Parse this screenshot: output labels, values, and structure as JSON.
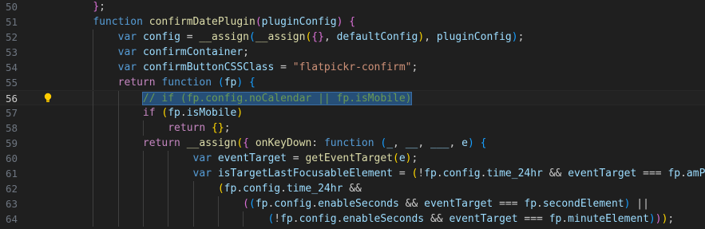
{
  "editor": {
    "language": "javascript",
    "active_line": 56,
    "lines": [
      {
        "num": "50",
        "tokens": [
          [
            "punc",
            "    "
          ],
          [
            "brk2",
            "}"
          ],
          [
            "punc",
            ";"
          ]
        ]
      },
      {
        "num": "51",
        "tokens": [
          [
            "punc",
            "    "
          ],
          [
            "kw-blue",
            "function"
          ],
          [
            "punc",
            " "
          ],
          [
            "fn",
            "confirmDatePlugin"
          ],
          [
            "brk2",
            "("
          ],
          [
            "var",
            "pluginConfig"
          ],
          [
            "brk2",
            ")"
          ],
          [
            "punc",
            " "
          ],
          [
            "brk2",
            "{"
          ]
        ]
      },
      {
        "num": "52",
        "tokens": [
          [
            "punc",
            "        "
          ],
          [
            "kw-blue",
            "var"
          ],
          [
            "punc",
            " "
          ],
          [
            "var",
            "config"
          ],
          [
            "punc",
            " = "
          ],
          [
            "fn",
            "__assign"
          ],
          [
            "brk3",
            "("
          ],
          [
            "fn",
            "__assign"
          ],
          [
            "brk1",
            "("
          ],
          [
            "brk2",
            "{}"
          ],
          [
            "punc",
            ", "
          ],
          [
            "var",
            "defaultConfig"
          ],
          [
            "brk1",
            ")"
          ],
          [
            "punc",
            ", "
          ],
          [
            "var",
            "pluginConfig"
          ],
          [
            "brk3",
            ")"
          ],
          [
            "punc",
            ";"
          ]
        ]
      },
      {
        "num": "53",
        "tokens": [
          [
            "punc",
            "        "
          ],
          [
            "kw-blue",
            "var"
          ],
          [
            "punc",
            " "
          ],
          [
            "var",
            "confirmContainer"
          ],
          [
            "punc",
            ";"
          ]
        ]
      },
      {
        "num": "54",
        "tokens": [
          [
            "punc",
            "        "
          ],
          [
            "kw-blue",
            "var"
          ],
          [
            "punc",
            " "
          ],
          [
            "var",
            "confirmButtonCSSClass"
          ],
          [
            "punc",
            " = "
          ],
          [
            "str",
            "\"flatpickr-confirm\""
          ],
          [
            "punc",
            ";"
          ]
        ]
      },
      {
        "num": "55",
        "tokens": [
          [
            "punc",
            "        "
          ],
          [
            "kw-ctrl",
            "return"
          ],
          [
            "punc",
            " "
          ],
          [
            "kw-blue",
            "function"
          ],
          [
            "punc",
            " "
          ],
          [
            "brk3",
            "("
          ],
          [
            "var",
            "fp"
          ],
          [
            "brk3",
            ")"
          ],
          [
            "punc",
            " "
          ],
          [
            "brk3",
            "{"
          ]
        ]
      },
      {
        "num": "56",
        "tokens": [
          [
            "punc",
            "            "
          ],
          [
            "cmt sel",
            "// if (fp.config.noCalendar || fp.isMobile)"
          ]
        ]
      },
      {
        "num": "57",
        "tokens": [
          [
            "punc",
            "            "
          ],
          [
            "kw-ctrl",
            "if"
          ],
          [
            "punc",
            " "
          ],
          [
            "brk1",
            "("
          ],
          [
            "var",
            "fp"
          ],
          [
            "punc",
            "."
          ],
          [
            "var",
            "isMobile"
          ],
          [
            "brk1",
            ")"
          ]
        ]
      },
      {
        "num": "58",
        "tokens": [
          [
            "punc",
            "                "
          ],
          [
            "kw-ctrl",
            "return"
          ],
          [
            "punc",
            " "
          ],
          [
            "brk1",
            "{}"
          ],
          [
            "punc",
            ";"
          ]
        ]
      },
      {
        "num": "59",
        "tokens": [
          [
            "punc",
            "            "
          ],
          [
            "kw-ctrl",
            "return"
          ],
          [
            "punc",
            " "
          ],
          [
            "fn",
            "__assign"
          ],
          [
            "brk1",
            "("
          ],
          [
            "brk2",
            "{"
          ],
          [
            "punc",
            " "
          ],
          [
            "fn",
            "onKeyDown"
          ],
          [
            "punc",
            ": "
          ],
          [
            "kw-blue",
            "function"
          ],
          [
            "punc",
            " "
          ],
          [
            "brk3",
            "("
          ],
          [
            "var",
            "_"
          ],
          [
            "punc",
            ", "
          ],
          [
            "var",
            "__"
          ],
          [
            "punc",
            ", "
          ],
          [
            "var",
            "___"
          ],
          [
            "punc",
            ", "
          ],
          [
            "var",
            "e"
          ],
          [
            "brk3",
            ")"
          ],
          [
            "punc",
            " "
          ],
          [
            "brk3",
            "{"
          ]
        ]
      },
      {
        "num": "60",
        "tokens": [
          [
            "punc",
            "                    "
          ],
          [
            "kw-blue",
            "var"
          ],
          [
            "punc",
            " "
          ],
          [
            "var",
            "eventTarget"
          ],
          [
            "punc",
            " = "
          ],
          [
            "fn",
            "getEventTarget"
          ],
          [
            "brk1",
            "("
          ],
          [
            "var",
            "e"
          ],
          [
            "brk1",
            ")"
          ],
          [
            "punc",
            ";"
          ]
        ]
      },
      {
        "num": "61",
        "tokens": [
          [
            "punc",
            "                    "
          ],
          [
            "kw-blue",
            "var"
          ],
          [
            "punc",
            " "
          ],
          [
            "var",
            "isTargetLastFocusableElement"
          ],
          [
            "punc",
            " = "
          ],
          [
            "brk1",
            "("
          ],
          [
            "punc",
            "!"
          ],
          [
            "var",
            "fp"
          ],
          [
            "punc",
            "."
          ],
          [
            "var",
            "config"
          ],
          [
            "punc",
            "."
          ],
          [
            "var",
            "time_24hr"
          ],
          [
            "punc",
            " && "
          ],
          [
            "var",
            "eventTarget"
          ],
          [
            "punc",
            " === "
          ],
          [
            "var",
            "fp"
          ],
          [
            "punc",
            "."
          ],
          [
            "var",
            "amPM"
          ],
          [
            "brk1",
            ")"
          ],
          [
            "punc",
            " ||"
          ]
        ]
      },
      {
        "num": "62",
        "tokens": [
          [
            "punc",
            "                        "
          ],
          [
            "brk1",
            "("
          ],
          [
            "var",
            "fp"
          ],
          [
            "punc",
            "."
          ],
          [
            "var",
            "config"
          ],
          [
            "punc",
            "."
          ],
          [
            "var",
            "time_24hr"
          ],
          [
            "punc",
            " &&"
          ]
        ]
      },
      {
        "num": "63",
        "tokens": [
          [
            "punc",
            "                            "
          ],
          [
            "brk2",
            "("
          ],
          [
            "brk3",
            "("
          ],
          [
            "var",
            "fp"
          ],
          [
            "punc",
            "."
          ],
          [
            "var",
            "config"
          ],
          [
            "punc",
            "."
          ],
          [
            "var",
            "enableSeconds"
          ],
          [
            "punc",
            " && "
          ],
          [
            "var",
            "eventTarget"
          ],
          [
            "punc",
            " === "
          ],
          [
            "var",
            "fp"
          ],
          [
            "punc",
            "."
          ],
          [
            "var",
            "secondElement"
          ],
          [
            "brk3",
            ")"
          ],
          [
            "punc",
            " ||"
          ]
        ]
      },
      {
        "num": "64",
        "tokens": [
          [
            "punc",
            "                                "
          ],
          [
            "brk3",
            "("
          ],
          [
            "punc",
            "!"
          ],
          [
            "var",
            "fp"
          ],
          [
            "punc",
            "."
          ],
          [
            "var",
            "config"
          ],
          [
            "punc",
            "."
          ],
          [
            "var",
            "enableSeconds"
          ],
          [
            "punc",
            " && "
          ],
          [
            "var",
            "eventTarget"
          ],
          [
            "punc",
            " === "
          ],
          [
            "var",
            "fp"
          ],
          [
            "punc",
            "."
          ],
          [
            "var",
            "minuteElement"
          ],
          [
            "brk3",
            ")"
          ],
          [
            "brk2",
            ")"
          ],
          [
            "brk1",
            ")"
          ],
          [
            "punc",
            ";"
          ]
        ]
      }
    ],
    "lightbulb_icon": "lightbulb-icon",
    "colors": {
      "background": "#1f1f1f",
      "keyword": "#569cd6",
      "control": "#c586c0",
      "function": "#dcdcaa",
      "variable": "#9cdcfe",
      "string": "#ce9178",
      "comment": "#6a9955",
      "selection": "#264f78"
    }
  }
}
